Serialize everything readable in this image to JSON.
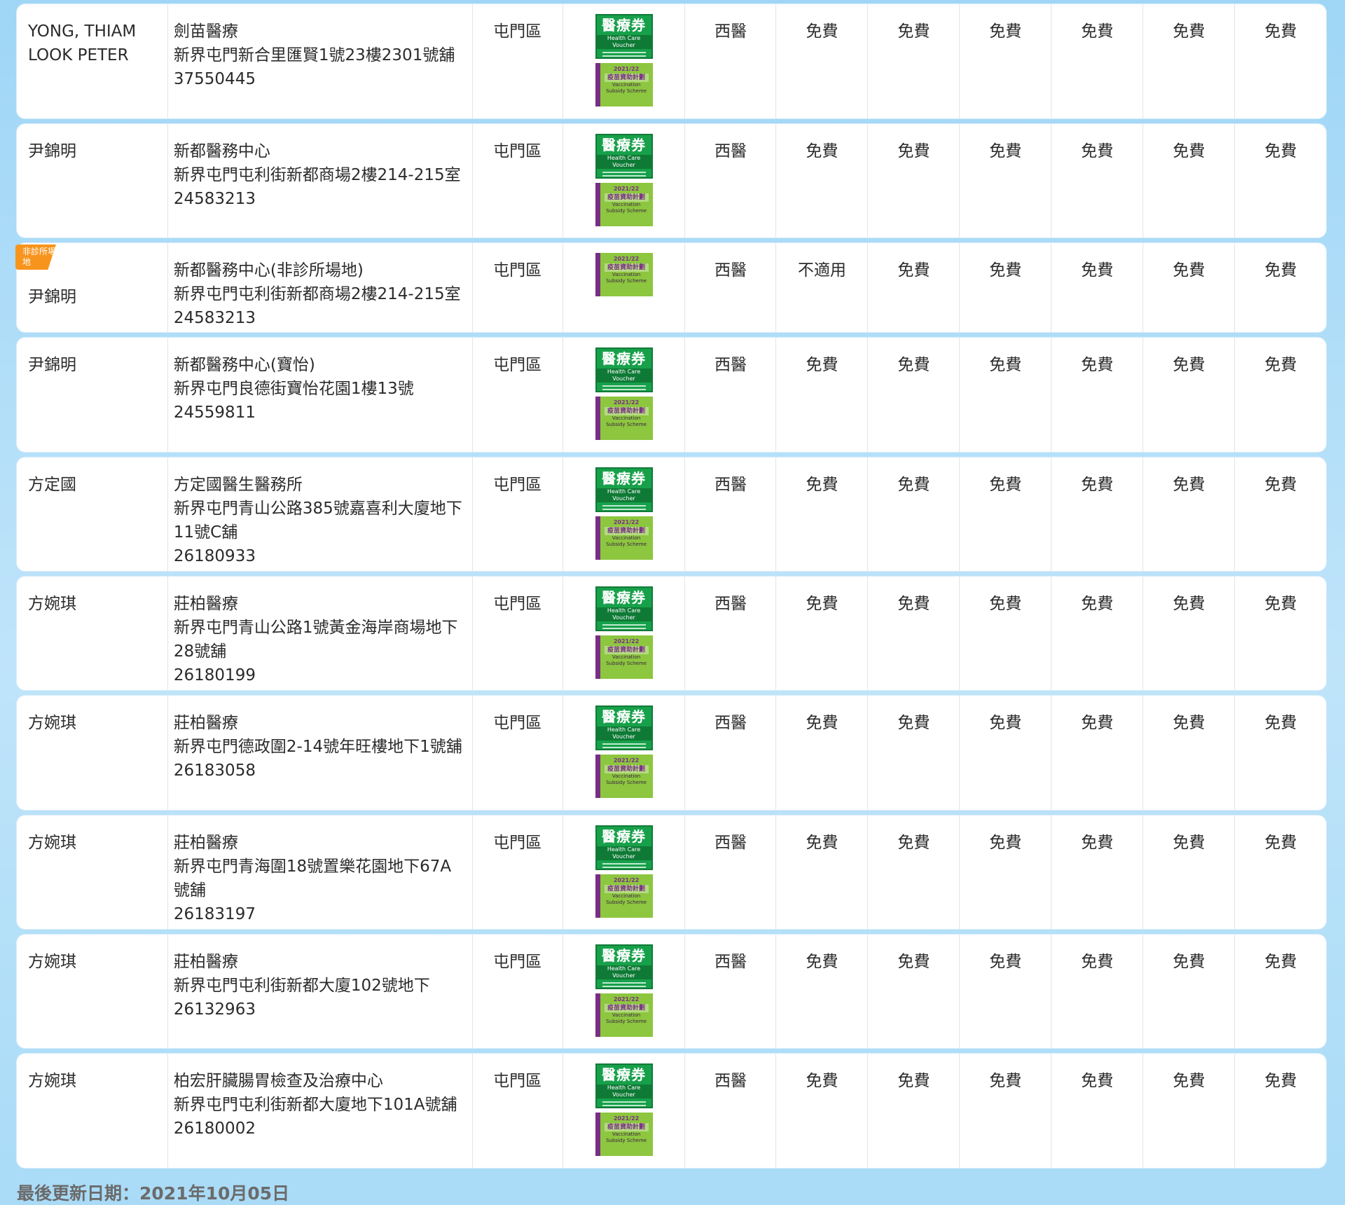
{
  "logos": {
    "hcv_zh": "醫療券",
    "hcv_en": "Health Care Voucher",
    "vss_year": "2021/22",
    "vss_zh": "疫苗資助計劃",
    "vss_en1": "Vaccination",
    "vss_en2": "Subsidy Scheme"
  },
  "rows": [
    {
      "doctor": "YONG, THIAM LOOK PETER",
      "badge": "",
      "clinic": "劍苗醫療",
      "address": "新界屯門新合里匯賢1號23樓2301號舖",
      "phone": "37550445",
      "district": "屯門區",
      "type": "西醫",
      "fees": [
        "免費",
        "免費",
        "免費",
        "免費",
        "免費",
        "免費"
      ],
      "has_hcv": true,
      "has_vss": true
    },
    {
      "doctor": "尹錦明",
      "badge": "",
      "clinic": "新都醫務中心",
      "address": "新界屯門屯利街新都商場2樓214-215室",
      "phone": "24583213",
      "district": "屯門區",
      "type": "西醫",
      "fees": [
        "免費",
        "免費",
        "免費",
        "免費",
        "免費",
        "免費"
      ],
      "has_hcv": true,
      "has_vss": true
    },
    {
      "doctor": "尹錦明",
      "badge": "非診所場地",
      "clinic": "新都醫務中心(非診所場地)",
      "address": "新界屯門屯利街新都商場2樓214-215室",
      "phone": "24583213",
      "district": "屯門區",
      "type": "西醫",
      "fees": [
        "不適用",
        "免費",
        "免費",
        "免費",
        "免費",
        "免費"
      ],
      "has_hcv": false,
      "has_vss": true
    },
    {
      "doctor": "尹錦明",
      "badge": "",
      "clinic": "新都醫務中心(寶怡)",
      "address": "新界屯門良德街寶怡花園1樓13號",
      "phone": "24559811",
      "district": "屯門區",
      "type": "西醫",
      "fees": [
        "免費",
        "免費",
        "免費",
        "免費",
        "免費",
        "免費"
      ],
      "has_hcv": true,
      "has_vss": true
    },
    {
      "doctor": "方定國",
      "badge": "",
      "clinic": "方定國醫生醫務所",
      "address": "新界屯門青山公路385號嘉喜利大廈地下11號C舖",
      "phone": "26180933",
      "district": "屯門區",
      "type": "西醫",
      "fees": [
        "免費",
        "免費",
        "免費",
        "免費",
        "免費",
        "免費"
      ],
      "has_hcv": true,
      "has_vss": true
    },
    {
      "doctor": "方婉琪",
      "badge": "",
      "clinic": "莊柏醫療",
      "address": "新界屯門青山公路1號黃金海岸商場地下28號舖",
      "phone": "26180199",
      "district": "屯門區",
      "type": "西醫",
      "fees": [
        "免費",
        "免費",
        "免費",
        "免費",
        "免費",
        "免費"
      ],
      "has_hcv": true,
      "has_vss": true
    },
    {
      "doctor": "方婉琪",
      "badge": "",
      "clinic": "莊柏醫療",
      "address": "新界屯門德政圍2-14號年旺樓地下1號舖",
      "phone": "26183058",
      "district": "屯門區",
      "type": "西醫",
      "fees": [
        "免費",
        "免費",
        "免費",
        "免費",
        "免費",
        "免費"
      ],
      "has_hcv": true,
      "has_vss": true
    },
    {
      "doctor": "方婉琪",
      "badge": "",
      "clinic": "莊柏醫療",
      "address": "新界屯門青海圍18號置樂花園地下67A號舖",
      "phone": "26183197",
      "district": "屯門區",
      "type": "西醫",
      "fees": [
        "免費",
        "免費",
        "免費",
        "免費",
        "免費",
        "免費"
      ],
      "has_hcv": true,
      "has_vss": true
    },
    {
      "doctor": "方婉琪",
      "badge": "",
      "clinic": "莊柏醫療",
      "address": "新界屯門屯利街新都大廈102號地下",
      "phone": "26132963",
      "district": "屯門區",
      "type": "西醫",
      "fees": [
        "免費",
        "免費",
        "免費",
        "免費",
        "免費",
        "免費"
      ],
      "has_hcv": true,
      "has_vss": true
    },
    {
      "doctor": "方婉琪",
      "badge": "",
      "clinic": "柏宏肝臟腸胃檢查及治療中心",
      "address": "新界屯門屯利街新都大廈地下101A號舖",
      "phone": "26180002",
      "district": "屯門區",
      "type": "西醫",
      "fees": [
        "免費",
        "免費",
        "免費",
        "免費",
        "免費",
        "免費"
      ],
      "has_hcv": true,
      "has_vss": true
    }
  ],
  "footer": {
    "last_updated": "最後更新日期：2021年10月05日"
  }
}
